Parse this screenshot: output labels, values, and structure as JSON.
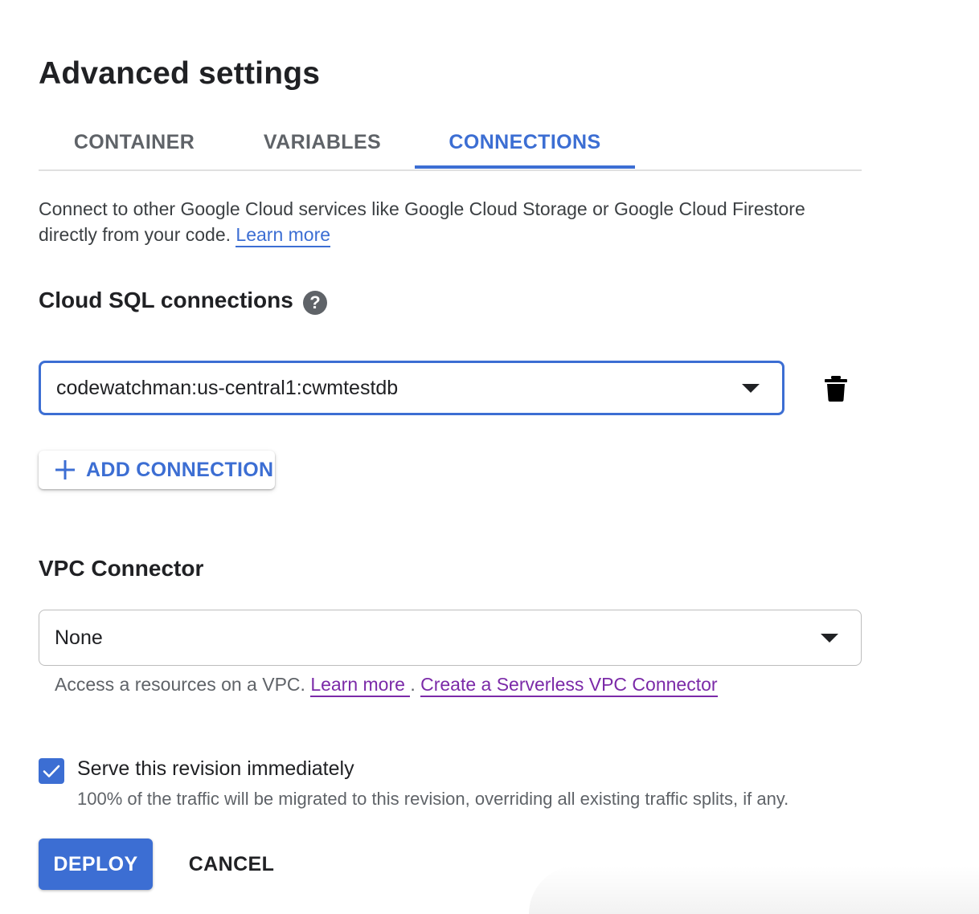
{
  "page": {
    "title": "Advanced settings"
  },
  "tabs": [
    {
      "label": "CONTAINER",
      "active": false
    },
    {
      "label": "VARIABLES",
      "active": false
    },
    {
      "label": "CONNECTIONS",
      "active": true
    }
  ],
  "intro": {
    "text": "Connect to other Google Cloud services like Google Cloud Storage or Google Cloud Firestore directly from your code.",
    "link": "Learn more"
  },
  "cloud_sql": {
    "title": "Cloud SQL connections",
    "help_icon": "help-circle-icon",
    "connection_value": "codewatchman:us-central1:cwmtestdb",
    "delete_icon": "trash-icon",
    "add_label": "ADD CONNECTION",
    "add_icon": "plus-icon"
  },
  "vpc": {
    "title": "VPC Connector",
    "value": "None",
    "helper_text": "Access a resources on a VPC.",
    "link_learn": "Learn more ",
    "separator": ".",
    "link_create": "Create a Serverless VPC Connector"
  },
  "serve": {
    "checked": true,
    "label": "Serve this revision immediately",
    "sublabel": "100% of the traffic will be migrated to this revision, overriding all existing traffic splits, if any."
  },
  "actions": {
    "deploy": "DEPLOY",
    "cancel": "CANCEL"
  },
  "colors": {
    "accent": "#3c6ed3",
    "visited_link": "#7b2aa8",
    "text": "#202124",
    "muted": "#5f6368"
  }
}
